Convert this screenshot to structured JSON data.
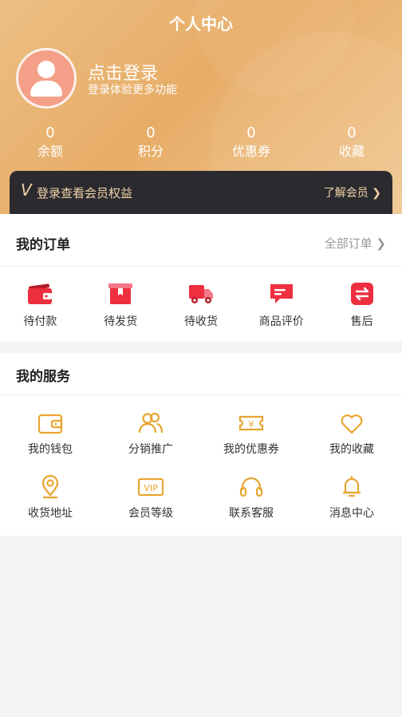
{
  "header": {
    "title": "个人中心",
    "login_title": "点击登录",
    "login_subtitle": "登录体验更多功能",
    "stats": [
      {
        "value": "0",
        "label": "余额"
      },
      {
        "value": "0",
        "label": "积分"
      },
      {
        "value": "0",
        "label": "优惠券"
      },
      {
        "value": "0",
        "label": "收藏"
      }
    ]
  },
  "member": {
    "text": "登录查看会员权益",
    "link": "了解会员 ❯"
  },
  "orders": {
    "title": "我的订单",
    "link": "全部订单 ❯",
    "items": [
      {
        "label": "待付款",
        "icon": "wallet-icon"
      },
      {
        "label": "待发货",
        "icon": "box-icon"
      },
      {
        "label": "待收货",
        "icon": "truck-icon"
      },
      {
        "label": "商品评价",
        "icon": "comment-icon"
      },
      {
        "label": "售后",
        "icon": "exchange-icon"
      }
    ]
  },
  "services": {
    "title": "我的服务",
    "items": [
      {
        "label": "我的钱包",
        "icon": "wallet-icon"
      },
      {
        "label": "分销推广",
        "icon": "users-icon"
      },
      {
        "label": "我的优惠券",
        "icon": "coupon-icon"
      },
      {
        "label": "我的收藏",
        "icon": "heart-icon"
      },
      {
        "label": "收货地址",
        "icon": "location-icon"
      },
      {
        "label": "会员等级",
        "icon": "vip-icon"
      },
      {
        "label": "联系客服",
        "icon": "headset-icon"
      },
      {
        "label": "消息中心",
        "icon": "bell-icon"
      }
    ]
  },
  "colors": {
    "header_gradient_start": "#ecbf84",
    "header_gradient_end": "#f0c893",
    "member_bar": "#2b2b2f",
    "member_text": "#f1d3a8",
    "order_icon_red": "#ee2f3f",
    "service_icon_orange": "#e8a530"
  }
}
